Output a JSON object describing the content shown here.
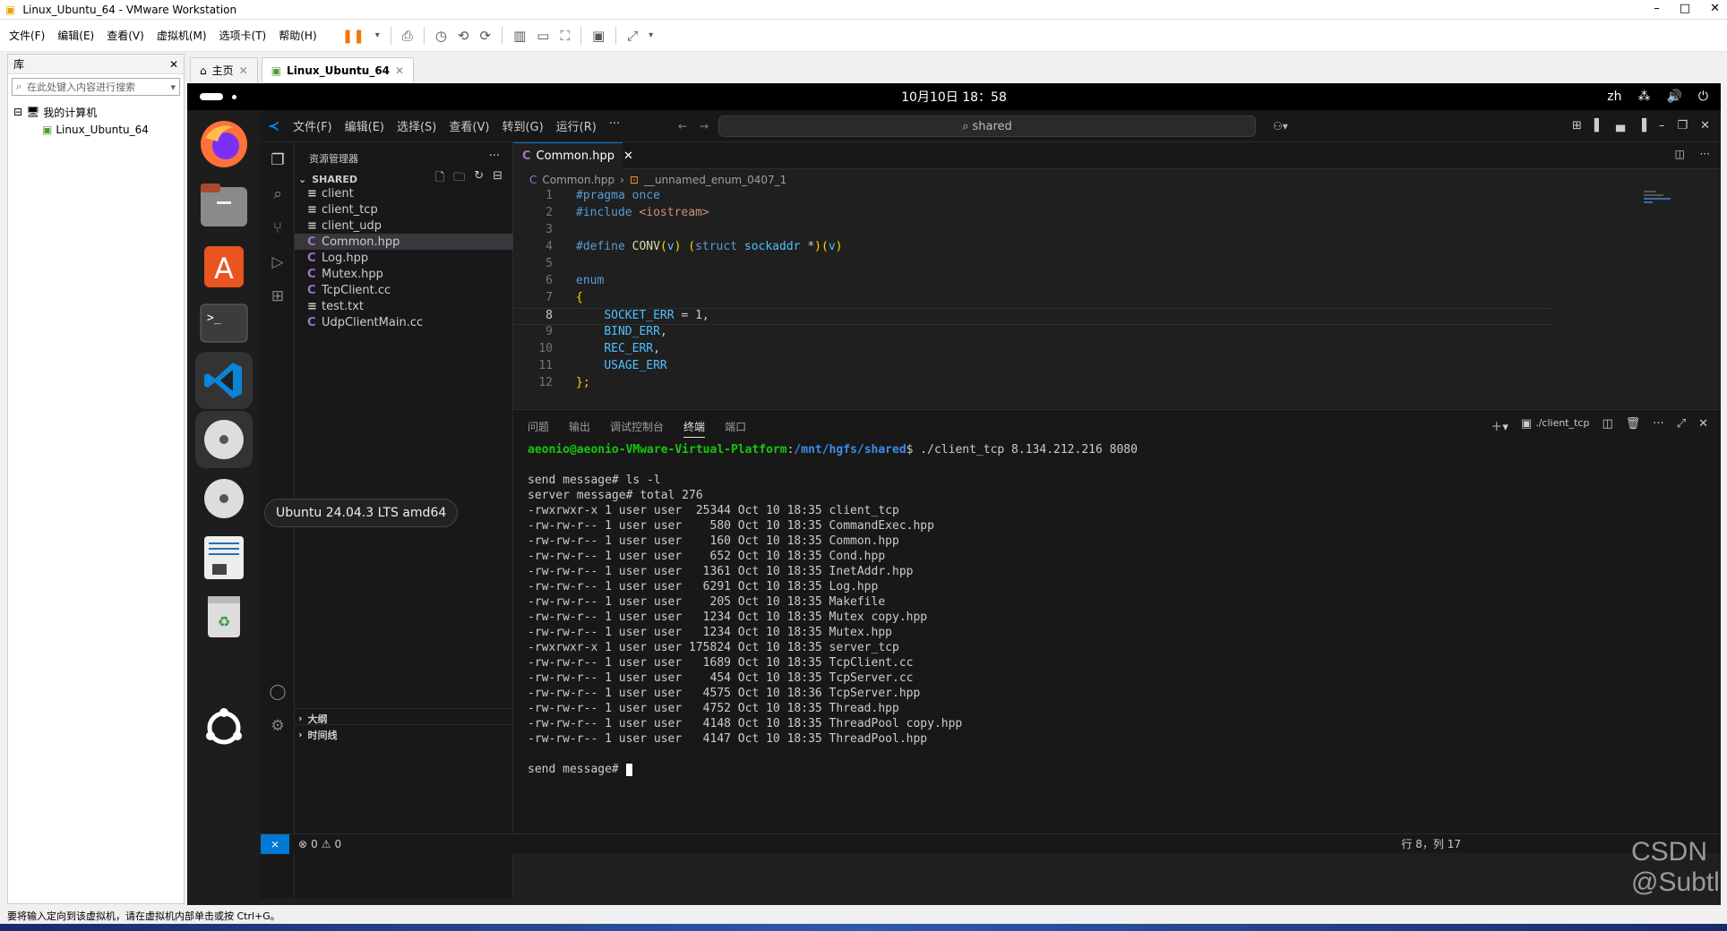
{
  "vm": {
    "title": "Linux_Ubuntu_64 - VMware Workstation",
    "menu": [
      "文件(F)",
      "编辑(E)",
      "查看(V)",
      "虚拟机(M)",
      "选项卡(T)",
      "帮助(H)"
    ],
    "library_title": "库",
    "library_search_placeholder": "在此处键入内容进行搜索",
    "tree_root": "我的计算机",
    "tree_vm": "Linux_Ubuntu_64",
    "tab_home": "主页",
    "tab_vm": "Linux_Ubuntu_64",
    "status_hint": "要将输入定向到该虚拟机，请在虚拟机内部单击或按 Ctrl+G。"
  },
  "gnome": {
    "clock": "10月10日  18：58",
    "lang": "zh",
    "tooltip": "Ubuntu 24.04.3 LTS amd64"
  },
  "vscode": {
    "menus": [
      "文件(F)",
      "编辑(E)",
      "选择(S)",
      "查看(V)",
      "转到(G)",
      "运行(R)",
      "···"
    ],
    "search": "shared",
    "explorer_title": "资源管理器",
    "folder": "SHARED",
    "files": [
      {
        "name": "client",
        "icon": "≡"
      },
      {
        "name": "client_tcp",
        "icon": "≡"
      },
      {
        "name": "client_udp",
        "icon": "≡"
      },
      {
        "name": "Common.hpp",
        "icon": "C"
      },
      {
        "name": "Log.hpp",
        "icon": "C"
      },
      {
        "name": "Mutex.hpp",
        "icon": "C"
      },
      {
        "name": "TcpClient.cc",
        "icon": "C"
      },
      {
        "name": "test.txt",
        "icon": "≡"
      },
      {
        "name": "UdpClientMain.cc",
        "icon": "C"
      }
    ],
    "outline": "大纲",
    "timeline": "时间线",
    "tab": "Common.hpp",
    "breadcrumb_file": "Common.hpp",
    "breadcrumb_symbol": "__unnamed_enum_0407_1",
    "panel_tabs": [
      "问题",
      "输出",
      "调试控制台",
      "终端",
      "端口"
    ],
    "terminal_name": "./client_tcp",
    "status_errors": "0",
    "status_warnings": "0",
    "status_right": "行 8，列 17"
  },
  "terminal": {
    "prompt_user": "aeonio@aeonio-VMware-Virtual-Platform",
    "prompt_path": "/mnt/hgfs/shared",
    "command": "$ ./client_tcp 8.134.212.216 8080",
    "lines": [
      "send message# ls -l",
      "server message# total 276",
      "-rwxrwxr-x 1 user user  25344 Oct 10 18:35 client_tcp",
      "-rw-rw-r-- 1 user user    580 Oct 10 18:35 CommandExec.hpp",
      "-rw-rw-r-- 1 user user    160 Oct 10 18:35 Common.hpp",
      "-rw-rw-r-- 1 user user    652 Oct 10 18:35 Cond.hpp",
      "-rw-rw-r-- 1 user user   1361 Oct 10 18:35 InetAddr.hpp",
      "-rw-rw-r-- 1 user user   6291 Oct 10 18:35 Log.hpp",
      "-rw-rw-r-- 1 user user    205 Oct 10 18:35 Makefile",
      "-rw-rw-r-- 1 user user   1234 Oct 10 18:35 Mutex copy.hpp",
      "-rw-rw-r-- 1 user user   1234 Oct 10 18:35 Mutex.hpp",
      "-rwxrwxr-x 1 user user 175824 Oct 10 18:35 server_tcp",
      "-rw-rw-r-- 1 user user   1689 Oct 10 18:35 TcpClient.cc",
      "-rw-rw-r-- 1 user user    454 Oct 10 18:35 TcpServer.cc",
      "-rw-rw-r-- 1 user user   4575 Oct 10 18:36 TcpServer.hpp",
      "-rw-rw-r-- 1 user user   4752 Oct 10 18:35 Thread.hpp",
      "-rw-rw-r-- 1 user user   4148 Oct 10 18:35 ThreadPool copy.hpp",
      "-rw-rw-r-- 1 user user   4147 Oct 10 18:35 ThreadPool.hpp"
    ],
    "final_prompt": "send message# "
  },
  "watermark": "CSDN @SubtleByte"
}
